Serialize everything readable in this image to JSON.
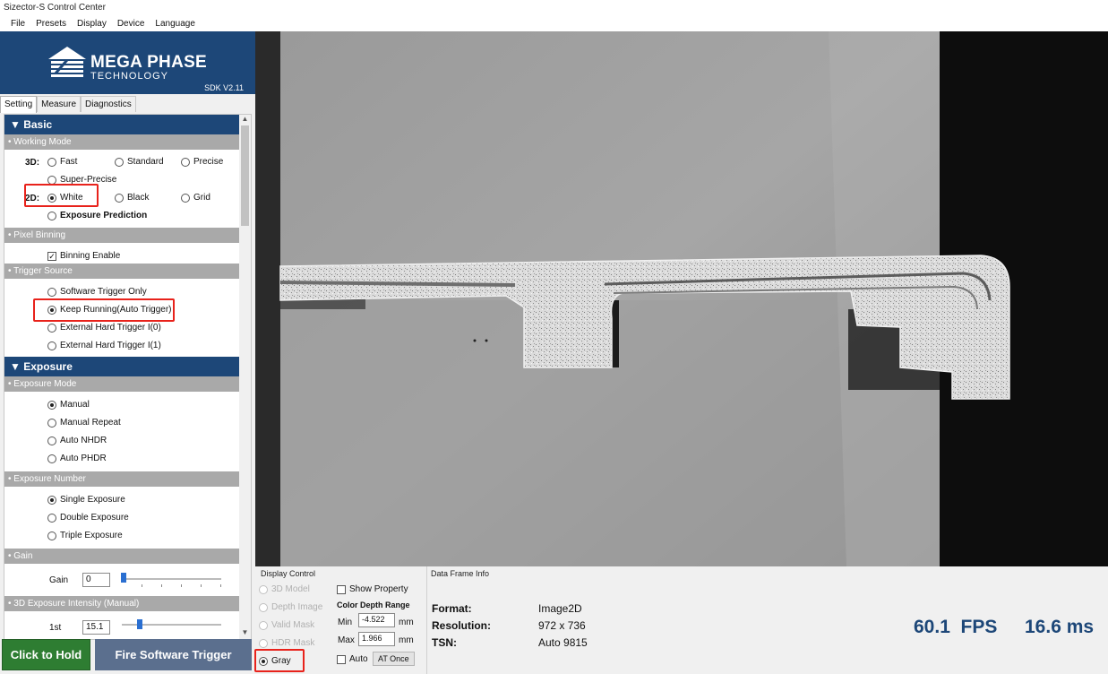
{
  "window_title": "Sizector-S Control Center",
  "menu": [
    "File",
    "Presets",
    "Display",
    "Device",
    "Language"
  ],
  "brand": {
    "name": "MEGA PHASE",
    "sub": "TECHNOLOGY",
    "sdk": "SDK V2.11",
    "color": "#1d4778"
  },
  "tabs": [
    "Setting",
    "Measure",
    "Diagnostics"
  ],
  "basic": {
    "title": "▼ Basic",
    "working_mode": {
      "title": "• Working Mode",
      "label_3d": "3D:",
      "label_2d": "2D:",
      "options_3d": [
        "Fast",
        "Standard",
        "Precise",
        "Super-Precise"
      ],
      "options_2d": [
        "White",
        "Black",
        "Grid"
      ],
      "selected_2d": "White",
      "exposure_prediction": "Exposure Prediction"
    },
    "pixel_binning": {
      "title": "• Pixel Binning",
      "checkbox": "Binning Enable",
      "checked": true
    },
    "trigger_source": {
      "title": "• Trigger Source",
      "options": [
        "Software Trigger Only",
        "Keep Running(Auto Trigger)",
        "External Hard Trigger I(0)",
        "External Hard Trigger I(1)"
      ],
      "selected": "Keep Running(Auto Trigger)"
    }
  },
  "exposure": {
    "title": "▼ Exposure",
    "mode": {
      "title": "• Exposure Mode",
      "options": [
        "Manual",
        "Manual Repeat",
        "Auto NHDR",
        "Auto PHDR"
      ],
      "selected": "Manual"
    },
    "number": {
      "title": "• Exposure Number",
      "options": [
        "Single Exposure",
        "Double Exposure",
        "Triple Exposure"
      ],
      "selected": "Single Exposure"
    },
    "gain": {
      "title": "• Gain",
      "label": "Gain",
      "value": "0",
      "level": 0.0
    },
    "intensity": {
      "title": "• 3D Exposure Intensity (Manual)",
      "label": "1st",
      "value": "15.1",
      "level": 0.15
    }
  },
  "buttons": {
    "hold": "Click to Hold",
    "fire": "Fire Software Trigger"
  },
  "display_control": {
    "title": "Display Control",
    "modes": [
      "3D Model",
      "Depth Image",
      "Valid Mask",
      "HDR Mask",
      "Gray"
    ],
    "selected": "Gray",
    "show_property": "Show Property",
    "color_depth_range": "Color Depth Range",
    "min_label": "Min",
    "min_value": "-4.522",
    "max_label": "Max",
    "max_value": "1.966",
    "unit": "mm",
    "auto": "Auto",
    "at_once": "AT Once"
  },
  "data_frame": {
    "title": "Data Frame Info",
    "format_label": "Format:",
    "format_value": "Image2D",
    "resolution_label": "Resolution:",
    "resolution_value": "972 x 736",
    "tsn_label": "TSN:",
    "tsn_value": "Auto 9815",
    "fps": "60.1  FPS",
    "ms": "16.6 ms"
  }
}
